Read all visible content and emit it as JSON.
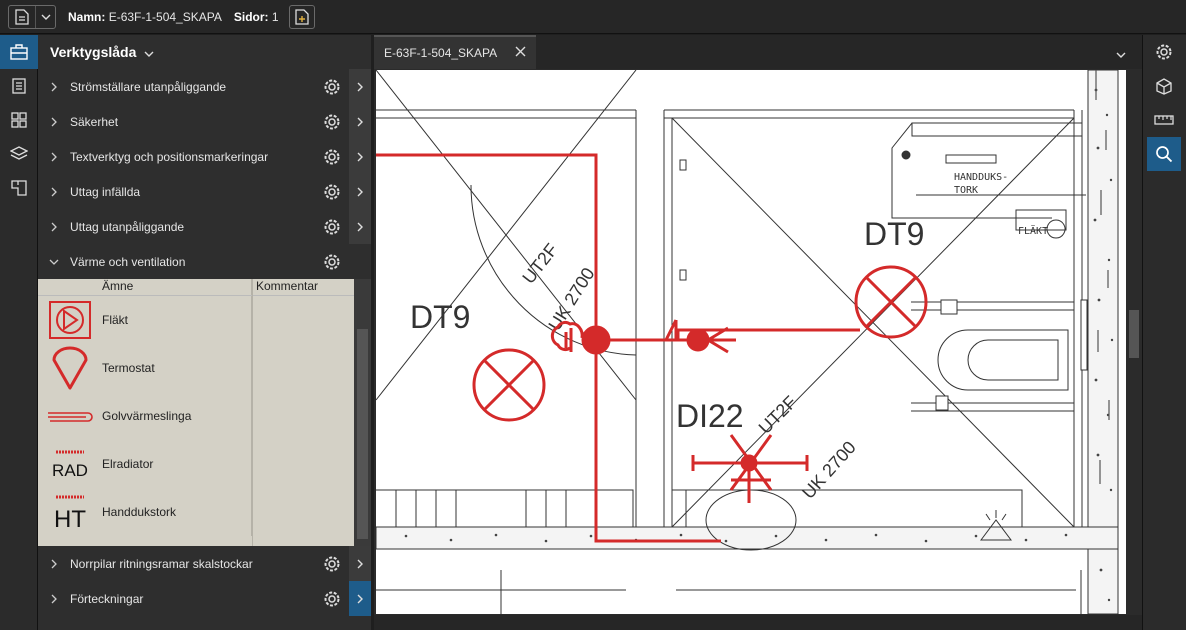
{
  "topbar": {
    "name_label": "Namn:",
    "name_value": "E-63F-1-504_SKAPA",
    "pages_label": "Sidor:",
    "pages_value": "1"
  },
  "toolbox": {
    "title": "Verktygslåda",
    "categories_top": [
      {
        "label": "Strömställare utanpåliggande"
      },
      {
        "label": "Säkerhet"
      },
      {
        "label": "Textverktyg och positionsmarkeringar"
      },
      {
        "label": "Uttag infällda"
      },
      {
        "label": "Uttag utanpåliggande"
      }
    ],
    "open_category": {
      "label": "Värme och ventilation"
    },
    "columns": {
      "subject": "Ämne",
      "comment": "Kommentar"
    },
    "symbols": [
      {
        "name": "Fläkt",
        "icon": "fan-symbol-icon"
      },
      {
        "name": "Termostat",
        "icon": "thermostat-symbol-icon"
      },
      {
        "name": "Golvvärmeslinga",
        "icon": "floor-heating-symbol-icon",
        "icon_text": ""
      },
      {
        "name": "Elradiator",
        "icon": "radiator-symbol-icon",
        "icon_text": "RAD"
      },
      {
        "name": "Handdukstork",
        "icon": "towel-dryer-symbol-icon",
        "icon_text": "HT"
      }
    ],
    "categories_bottom": [
      {
        "label": "Norrpilar ritningsramar skalstockar"
      },
      {
        "label": "Förteckningar"
      }
    ]
  },
  "document": {
    "tab_title": "E-63F-1-504_SKAPA"
  },
  "drawing": {
    "labels": {
      "dt9_left": "DT9",
      "dt9_right": "DT9",
      "di22": "DI22",
      "ut2f_top": "UT2F",
      "uk2700": "UK 2700",
      "ut2f_mid": "UT2F",
      "uk2700_mid": "UK 2700",
      "handdukstork": "HANDDUKS-\nTORK",
      "flakt": "FLÄKT"
    },
    "colors": {
      "markup": "#d42a2a",
      "ink": "#333333"
    }
  }
}
